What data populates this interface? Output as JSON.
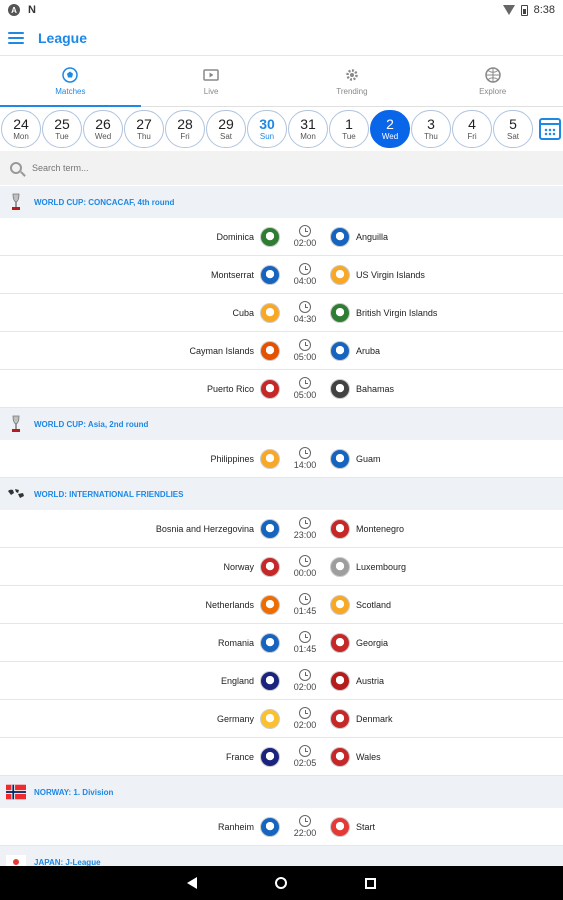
{
  "status_bar": {
    "time": "8:38",
    "notif_letter": "N"
  },
  "app": {
    "title": "League"
  },
  "tabs": [
    {
      "label": "Matches",
      "icon": "soccer-ball-icon",
      "active": true
    },
    {
      "label": "Live",
      "icon": "tv-icon",
      "active": false
    },
    {
      "label": "Trending",
      "icon": "gear-icon",
      "active": false
    },
    {
      "label": "Explore",
      "icon": "globe-ball-icon",
      "active": false
    }
  ],
  "dates": [
    {
      "num": "24",
      "day": "Mon"
    },
    {
      "num": "25",
      "day": "Tue"
    },
    {
      "num": "26",
      "day": "Wed"
    },
    {
      "num": "27",
      "day": "Thu"
    },
    {
      "num": "28",
      "day": "Fri"
    },
    {
      "num": "29",
      "day": "Sat"
    },
    {
      "num": "30",
      "day": "Sun",
      "state": "today"
    },
    {
      "num": "31",
      "day": "Mon"
    },
    {
      "num": "1",
      "day": "Tue"
    },
    {
      "num": "2",
      "day": "Wed",
      "state": "selected"
    },
    {
      "num": "3",
      "day": "Thu"
    },
    {
      "num": "4",
      "day": "Fri"
    },
    {
      "num": "5",
      "day": "Sat"
    }
  ],
  "search": {
    "placeholder": "Search term..."
  },
  "leagues": [
    {
      "name": "WORLD CUP: CONCACAF, 4th round",
      "icon": "trophy-icon",
      "matches": [
        {
          "home": "Dominica",
          "time": "02:00",
          "away": "Anguilla",
          "home_color": "#2e7d32",
          "away_color": "#1565c0"
        },
        {
          "home": "Montserrat",
          "time": "04:00",
          "away": "US Virgin Islands",
          "home_color": "#1565c0",
          "away_color": "#f9a825"
        },
        {
          "home": "Cuba",
          "time": "04:30",
          "away": "British Virgin Islands",
          "home_color": "#f9a825",
          "away_color": "#2e7d32"
        },
        {
          "home": "Cayman Islands",
          "time": "05:00",
          "away": "Aruba",
          "home_color": "#e65100",
          "away_color": "#1565c0"
        },
        {
          "home": "Puerto Rico",
          "time": "05:00",
          "away": "Bahamas",
          "home_color": "#c62828",
          "away_color": "#424242"
        }
      ]
    },
    {
      "name": "WORLD CUP: Asia, 2nd round",
      "icon": "trophy-icon",
      "matches": [
        {
          "home": "Philippines",
          "time": "14:00",
          "away": "Guam",
          "home_color": "#f9a825",
          "away_color": "#1565c0"
        }
      ]
    },
    {
      "name": "WORLD: INTERNATIONAL FRIENDLIES",
      "icon": "world-map-icon",
      "matches": [
        {
          "home": "Bosnia and Herzegovina",
          "time": "23:00",
          "away": "Montenegro",
          "home_color": "#1565c0",
          "away_color": "#c62828"
        },
        {
          "home": "Norway",
          "time": "00:00",
          "away": "Luxembourg",
          "home_color": "#c62828",
          "away_color": "#9e9e9e"
        },
        {
          "home": "Netherlands",
          "time": "01:45",
          "away": "Scotland",
          "home_color": "#ef6c00",
          "away_color": "#f9a825"
        },
        {
          "home": "Romania",
          "time": "01:45",
          "away": "Georgia",
          "home_color": "#1565c0",
          "away_color": "#c62828"
        },
        {
          "home": "England",
          "time": "02:00",
          "away": "Austria",
          "home_color": "#1a237e",
          "away_color": "#b71c1c"
        },
        {
          "home": "Germany",
          "time": "02:00",
          "away": "Denmark",
          "home_color": "#fbc02d",
          "away_color": "#c62828"
        },
        {
          "home": "France",
          "time": "02:05",
          "away": "Wales",
          "home_color": "#1a237e",
          "away_color": "#c62828"
        }
      ]
    },
    {
      "name": "NORWAY: 1. Division",
      "icon": "norway-flag-icon",
      "matches": [
        {
          "home": "Ranheim",
          "time": "22:00",
          "away": "Start",
          "home_color": "#1565c0",
          "away_color": "#e53935"
        }
      ]
    },
    {
      "name": "JAPAN: J-League",
      "icon": "japan-flag-icon",
      "matches": []
    }
  ],
  "colors": {
    "accent": "#1e88e5",
    "selected_date": "#0a66e8",
    "league_bg": "#eef1f5"
  }
}
